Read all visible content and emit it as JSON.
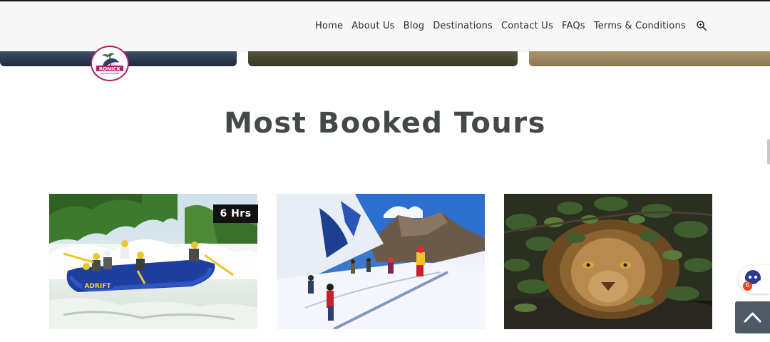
{
  "nav": {
    "items": [
      {
        "label": "Home"
      },
      {
        "label": "About Us"
      },
      {
        "label": "Blog"
      },
      {
        "label": "Destinations"
      },
      {
        "label": "Contact Us"
      },
      {
        "label": "FAQs"
      },
      {
        "label": "Terms & Conditions"
      }
    ],
    "search_icon": "search-icon"
  },
  "logo": {
    "text": "RONICK"
  },
  "section": {
    "title": "Most Booked Tours"
  },
  "tours": [
    {
      "duration": "6 Hrs",
      "raft_text": "ADRIFT",
      "image": "white-water-rafting"
    },
    {
      "image": "snow-mountain-hikers"
    },
    {
      "image": "lion-in-foliage"
    }
  ],
  "chat": {
    "count": "6",
    "icon": "chat-bot-icon"
  },
  "back_to_top": {
    "icon": "chevron-up-icon"
  },
  "colors": {
    "heading": "#444846",
    "nav_text": "#2e2e2e",
    "badge_bg": "#111111",
    "chat_badge": "#e6451f",
    "totop_bg": "#4d5a63"
  }
}
